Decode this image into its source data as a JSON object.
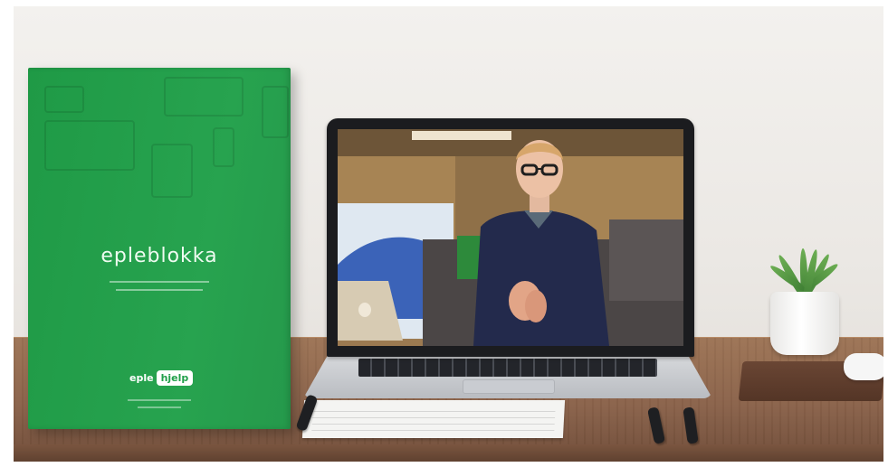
{
  "booklet": {
    "title": "epleblokka",
    "logo_left": "eple",
    "logo_right": "hjelp"
  },
  "colors": {
    "booklet_green": "#22a04b",
    "wall": "#efece8",
    "desk_wood": "#8c634b",
    "laptop_frame": "#1b1c1f"
  },
  "icons": {
    "booklet_devices": [
      "laptop-icon",
      "tablet-icon",
      "phone-icon",
      "monitor-icon"
    ]
  }
}
